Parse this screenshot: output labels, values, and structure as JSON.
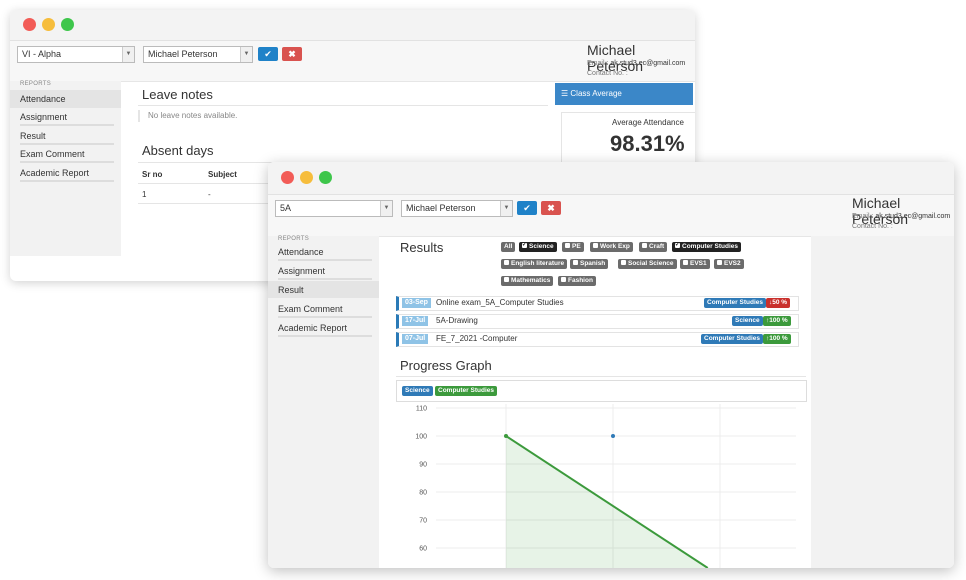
{
  "back_window": {
    "class_select": "VI - Alpha",
    "student_select": "Michael Peterson",
    "profile": {
      "name": "Michael Peterson",
      "email_label": "Email :",
      "email": "ak.stud3.ec@gmail.com",
      "contact_label": "Contact No. :"
    },
    "sidebar": {
      "heading": "REPORTS",
      "items": [
        "Attendance",
        "Assignment",
        "Result",
        "Exam Comment",
        "Academic Report"
      ],
      "active": "Attendance"
    },
    "leave_notes": {
      "title": "Leave notes",
      "empty": "No leave notes available."
    },
    "absent_days": {
      "title": "Absent days",
      "columns": [
        "Sr no",
        "Subject"
      ],
      "rows": [
        [
          "1",
          "-"
        ]
      ]
    },
    "class_average": {
      "header": "Class Average",
      "label": "Average Attendance",
      "value": "98.31%"
    }
  },
  "front_window": {
    "class_select": "5A",
    "student_select": "Michael Peterson",
    "profile": {
      "name": "Michael Peterson",
      "email_label": "Email :",
      "email": "ak.stud3.ec@gmail.com",
      "contact_label": "Contact No. :"
    },
    "sidebar": {
      "heading": "REPORTS",
      "items": [
        "Attendance",
        "Assignment",
        "Result",
        "Exam Comment",
        "Academic Report"
      ],
      "active": "Result"
    },
    "results": {
      "title": "Results",
      "filters": [
        {
          "label": "All",
          "checked": null
        },
        {
          "label": "Science",
          "checked": true
        },
        {
          "label": "PE",
          "checked": false
        },
        {
          "label": "Work Exp",
          "checked": false
        },
        {
          "label": "Craft",
          "checked": false
        },
        {
          "label": "Computer Studies",
          "checked": true
        },
        {
          "label": "English literature",
          "checked": false
        },
        {
          "label": "Spanish",
          "checked": false
        },
        {
          "label": "Social Science",
          "checked": false
        },
        {
          "label": "EVS1",
          "checked": false
        },
        {
          "label": "EVS2",
          "checked": false
        },
        {
          "label": "Mathematics",
          "checked": false
        },
        {
          "label": "Fashion",
          "checked": false
        }
      ],
      "rows": [
        {
          "date": "03-Sep",
          "title": "Online exam_5A_Computer Studies",
          "subject": "Computer Studies",
          "score": "50 %",
          "trend": "down"
        },
        {
          "date": "17-Jul",
          "title": "5A-Drawing",
          "subject": "Science",
          "score": "100 %",
          "trend": "up"
        },
        {
          "date": "07-Jul",
          "title": "FE_7_2021 -Computer",
          "subject": "Computer Studies",
          "score": "100 %",
          "trend": "up"
        }
      ]
    },
    "progress": {
      "title": "Progress Graph",
      "legend": [
        "Science",
        "Computer Studies"
      ]
    }
  },
  "colors": {
    "science": "#2f7ab7",
    "computer_studies": "#3c9a3c",
    "accent_blue": "#1f82c8",
    "danger": "#d9534f"
  },
  "chart_data": {
    "type": "line",
    "series": [
      {
        "name": "Computer Studies",
        "values": [
          100,
          75,
          50
        ]
      },
      {
        "name": "Science",
        "values": [
          null,
          100,
          null
        ]
      }
    ],
    "yticks": [
      "110",
      "100",
      "90",
      "80",
      "70",
      "60"
    ],
    "ylim": [
      55,
      110
    ]
  }
}
